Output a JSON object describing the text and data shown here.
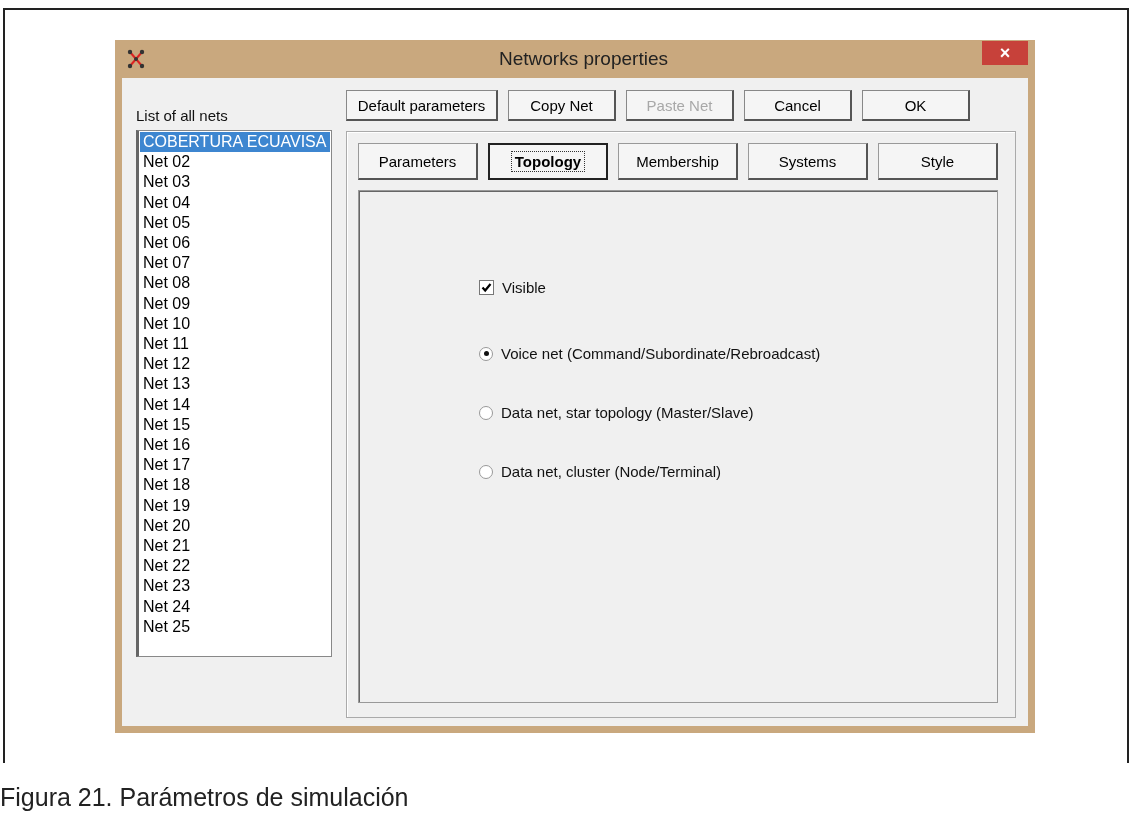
{
  "window": {
    "title": "Networks properties",
    "close": "×"
  },
  "net_list": {
    "label": "List of all nets",
    "items": [
      {
        "label": "COBERTURA ECUAVISA",
        "selected": true
      },
      {
        "label": "Net 02",
        "selected": false
      },
      {
        "label": "Net 03",
        "selected": false
      },
      {
        "label": "Net 04",
        "selected": false
      },
      {
        "label": "Net 05",
        "selected": false
      },
      {
        "label": "Net 06",
        "selected": false
      },
      {
        "label": "Net 07",
        "selected": false
      },
      {
        "label": "Net 08",
        "selected": false
      },
      {
        "label": "Net 09",
        "selected": false
      },
      {
        "label": "Net 10",
        "selected": false
      },
      {
        "label": "Net 11",
        "selected": false
      },
      {
        "label": "Net 12",
        "selected": false
      },
      {
        "label": "Net 13",
        "selected": false
      },
      {
        "label": "Net 14",
        "selected": false
      },
      {
        "label": "Net 15",
        "selected": false
      },
      {
        "label": "Net 16",
        "selected": false
      },
      {
        "label": "Net 17",
        "selected": false
      },
      {
        "label": "Net 18",
        "selected": false
      },
      {
        "label": "Net 19",
        "selected": false
      },
      {
        "label": "Net 20",
        "selected": false
      },
      {
        "label": "Net 21",
        "selected": false
      },
      {
        "label": "Net 22",
        "selected": false
      },
      {
        "label": "Net 23",
        "selected": false
      },
      {
        "label": "Net 24",
        "selected": false
      },
      {
        "label": "Net 25",
        "selected": false
      }
    ]
  },
  "buttons": [
    {
      "label": "Default parameters",
      "disabled": false
    },
    {
      "label": "Copy Net",
      "disabled": false
    },
    {
      "label": "Paste Net",
      "disabled": true
    },
    {
      "label": "Cancel",
      "disabled": false
    },
    {
      "label": "OK",
      "disabled": false
    }
  ],
  "tabs": [
    {
      "label": "Parameters",
      "selected": false
    },
    {
      "label": "Topology",
      "selected": true
    },
    {
      "label": "Membership",
      "selected": false
    },
    {
      "label": "Systems",
      "selected": false
    },
    {
      "label": "Style",
      "selected": false
    }
  ],
  "visible": {
    "label": "Visible",
    "checked": true
  },
  "topology_options": [
    {
      "label": "Voice net (Command/Subordinate/Rebroadcast)",
      "selected": true
    },
    {
      "label": "Data net, star topology (Master/Slave)",
      "selected": false
    },
    {
      "label": "Data net, cluster (Node/Terminal)",
      "selected": false
    }
  ],
  "caption": "Figura 21. Parámetros de simulación"
}
